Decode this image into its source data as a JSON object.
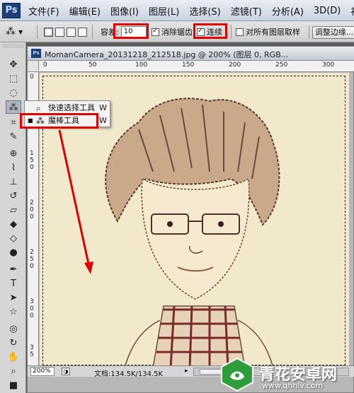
{
  "app": {
    "logo_text": "Ps"
  },
  "menubar": {
    "items": [
      "文件(F)",
      "编辑(E)",
      "图像(I)",
      "图层(L)",
      "选择(S)",
      "滤镜(T)",
      "分析(A)",
      "3D(D)",
      "视"
    ]
  },
  "options": {
    "tolerance_label": "容差:",
    "tolerance_value": "10",
    "antialias_label": "消除锯齿",
    "contiguous_label": "连续",
    "all_layers_label": "对所有图层取样",
    "refine_edge_label": "调整边缘..."
  },
  "document": {
    "title": "MomanCamera_20131218_212518.jpg @ 200% (图层 0, RGB...",
    "ruler_h": [
      "0",
      "50",
      "100",
      "150",
      "200",
      "250",
      "300"
    ],
    "ruler_v": [
      "0",
      "5",
      "1",
      "0",
      "1",
      "5",
      "0",
      "2",
      "0",
      "0",
      "2",
      "5",
      "0",
      "3",
      "0",
      "0",
      "3",
      "5"
    ],
    "zoom": "200%",
    "doc_size": "文档:134.5K/134.5K"
  },
  "flyout": {
    "items": [
      {
        "name": "快速选择工具",
        "shortcut": "W",
        "icon": "quick-selection-icon",
        "selected": false
      },
      {
        "name": "魔棒工具",
        "shortcut": "W",
        "icon": "magic-wand-icon",
        "selected": true
      }
    ]
  },
  "watermark": {
    "title": "青花安卓网",
    "url": "www.qhhlv.com"
  },
  "colors": {
    "highlight": "#e00000",
    "canvas": "#f2e8cb",
    "sketch": "#6b4a3a"
  }
}
